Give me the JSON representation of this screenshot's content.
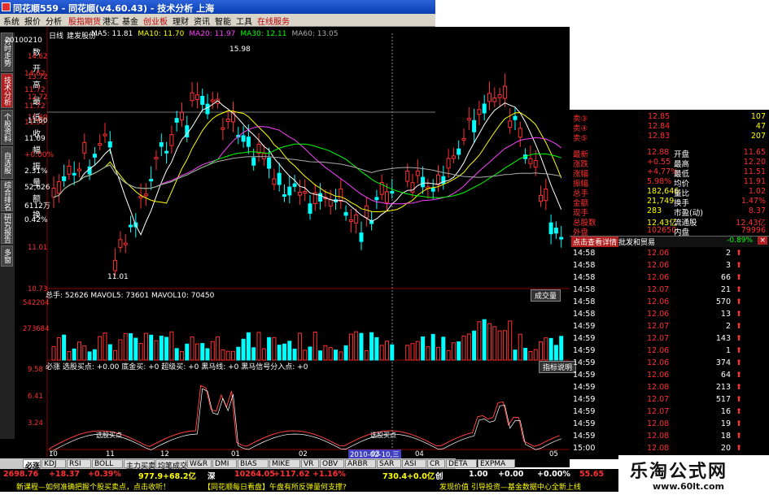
{
  "window": {
    "title": "同花顺559 - 同花顺(v4.60.43) - 技术分析 上海"
  },
  "menu": [
    "系统",
    "报价",
    "分析",
    "股指期货",
    "港汇",
    "基金",
    "创业板",
    "理财",
    "资讯",
    "智能",
    "工具",
    "在线服务"
  ],
  "left_tabs": [
    "分时走势",
    "技术分析",
    "个股资料",
    "自选股",
    "综合排名",
    "研究报告",
    "多窗"
  ],
  "info_panel": {
    "date_label": "20100210",
    "rows": [
      {
        "label": "数",
        "value": ""
      },
      {
        "label": "开",
        "value": "14.62"
      },
      {
        "label": "高",
        "value": "11.72"
      },
      {
        "label": "最",
        "value": "11.72"
      },
      {
        "label": "低",
        "value": "11.50"
      },
      {
        "label": "收",
        "value": "11.69"
      },
      {
        "label": "幅",
        "value": "+0.00%"
      },
      {
        "label": "振",
        "value": "2.31%"
      },
      {
        "label": "量",
        "value": "52,626"
      },
      {
        "label": "额",
        "value": "6112万"
      },
      {
        "label": "换",
        "value": "0.42%"
      }
    ]
  },
  "kline": {
    "stock_name": "建发股份",
    "period": "日线",
    "ma_legend": [
      {
        "text": "MA5: 11.81",
        "color": "#ffffff"
      },
      {
        "text": "MA10: 11.70",
        "color": "#ffff00"
      },
      {
        "text": "MA20: 11.97",
        "color": "#ff40ff"
      },
      {
        "text": "MA30: 12.11",
        "color": "#00ff00"
      },
      {
        "text": "MA60: 13.05",
        "color": "#aaaaaa"
      }
    ],
    "price_axis": [
      "14.62",
      "13.72",
      "12.72",
      "11.60",
      "11.50",
      "11.01",
      "10.73"
    ],
    "high_mark": "15.98",
    "low_mark": "11.01",
    "crosshair_price": "11.50"
  },
  "volume_panel": {
    "legend": "总手: 52626  MAVOL5: 73601  MAVOL10: 70450",
    "button": "成交量",
    "axis": [
      "542204",
      "273684"
    ]
  },
  "indicator_panel": {
    "legend": "必涨  选股买点: +0.00  底金买: +0  超级买: +0  黑马线: +0  黑马信号分入点: +0",
    "button": "指标说明",
    "axis": [
      "9.58",
      "6.41",
      "3.24"
    ],
    "markers": [
      "选股买点",
      "选股买点"
    ],
    "date_label": "2010-02-10,三",
    "months": [
      "10",
      "11",
      "12",
      "01",
      "02",
      "03",
      "04",
      "05"
    ]
  },
  "bottom_tabs": [
    "必涨",
    "KDJ",
    "RSI",
    "BOLL",
    "主力买卖",
    "均笔成交",
    "W&R",
    "DMI",
    "BIAS",
    "MIKE",
    "VR",
    "OBV",
    "ARBR",
    "SAR",
    "ASI",
    "CR",
    "DETA",
    "EXPMA"
  ],
  "status_bar": {
    "sh_index": "2698.76",
    "sh_change": "+18.37",
    "sh_pct": "+0.39%",
    "sh_amount": "977.9+68.2亿",
    "sz_label": "深",
    "sz_index": "10264.05",
    "sz_change": "+117.62",
    "sz_pct": "+1.16%",
    "sz_amount": "730.4+0.0亿",
    "cy_label": "创",
    "cy_index": "1.00",
    "cy_change": "+0.00",
    "cy_pct": "+0.00%",
    "right": "55.65"
  },
  "ticker": [
    {
      "text": "新课程—如何准确把握个股买卖点，点击收听！",
      "color": "#ffff00"
    },
    {
      "text": "【同花顺每日看盘】午盘有所反弹量何支撑?",
      "color": "#ffff00"
    },
    {
      "text": "发现价值 引导投资—基金数据中心全新上线",
      "color": "#ffff00"
    }
  ],
  "quote_panel": {
    "asks": [
      {
        "label": "卖③",
        "price": "12.85",
        "vol": "107"
      },
      {
        "label": "卖④",
        "price": "12.84",
        "vol": "47"
      },
      {
        "label": "卖⑤",
        "price": "12.83",
        "vol": "207"
      }
    ],
    "stats": [
      {
        "l1": "最新",
        "v1": "12.88",
        "l2": "开盘",
        "v2": "11.65"
      },
      {
        "l1": "涨跌",
        "v1": "+0.55",
        "l2": "最高",
        "v2": "12.20"
      },
      {
        "l1": "涨幅",
        "v1": "+4.77%",
        "l2": "最低",
        "v2": "11.51"
      },
      {
        "l1": "振幅",
        "v1": "5.98%",
        "l2": "均价",
        "v2": "11.91"
      },
      {
        "l1": "总手",
        "v1": "182,646",
        "l2": "量比",
        "v2": "1.02"
      },
      {
        "l1": "金额",
        "v1": "21,749",
        "l2": "换手",
        "v2": "1.47%"
      },
      {
        "l1": "现手",
        "v1": "283",
        "l2": "市盈(动)",
        "v2": "8.37"
      },
      {
        "l1": "总股数",
        "v1": "12.43亿",
        "l2": "流通股",
        "v2": "12.43亿"
      },
      {
        "l1": "外盘",
        "v1": "102650",
        "l2": "内盘",
        "v2": "79996"
      }
    ],
    "header_btn": "点击查看详情",
    "header_text": "批发和贸易",
    "header_pct": "-0.89%",
    "ticks": [
      {
        "time": "14:58",
        "price": "12.06",
        "vol": "2",
        "dir": "up"
      },
      {
        "time": "14:58",
        "price": "12.06",
        "vol": "3",
        "dir": "up"
      },
      {
        "time": "14:58",
        "price": "12.06",
        "vol": "66",
        "dir": "up"
      },
      {
        "time": "14:58",
        "price": "12.07",
        "vol": "21",
        "dir": "up"
      },
      {
        "time": "14:58",
        "price": "12.06",
        "vol": "570",
        "dir": "up"
      },
      {
        "time": "14:58",
        "price": "12.06",
        "vol": "13",
        "dir": "up"
      },
      {
        "time": "14:59",
        "price": "12.07",
        "vol": "2",
        "dir": "up"
      },
      {
        "time": "14:59",
        "price": "12.07",
        "vol": "143",
        "dir": "up"
      },
      {
        "time": "14:59",
        "price": "12.06",
        "vol": "1",
        "dir": "up"
      },
      {
        "time": "14:59",
        "price": "12.06",
        "vol": "374",
        "dir": "up"
      },
      {
        "time": "14:59",
        "price": "12.06",
        "vol": "64",
        "dir": "up"
      },
      {
        "time": "14:59",
        "price": "12.08",
        "vol": "213",
        "dir": "up"
      },
      {
        "time": "14:59",
        "price": "12.07",
        "vol": "517",
        "dir": "up"
      },
      {
        "time": "14:59",
        "price": "12.07",
        "vol": "16",
        "dir": "up"
      },
      {
        "time": "14:59",
        "price": "12.08",
        "vol": "19",
        "dir": "up"
      },
      {
        "time": "14:59",
        "price": "12.08",
        "vol": "18",
        "dir": "up"
      },
      {
        "time": "15:00",
        "price": "12.08",
        "vol": "20",
        "dir": "up"
      }
    ]
  },
  "watermark": {
    "line1": "乐淘公式网",
    "line2": "www.60lt.com"
  }
}
